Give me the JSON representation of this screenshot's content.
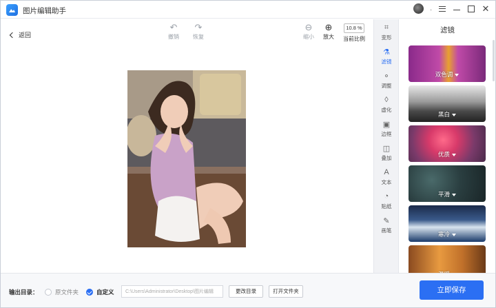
{
  "app": {
    "title": "图片编辑助手",
    "user_dot": "."
  },
  "toolbar": {
    "back": "返回",
    "undo": "撤销",
    "redo": "恢复",
    "zoom_out": "缩小",
    "zoom_in": "放大",
    "zoom_value": "10.8 %",
    "current_ratio": "当前比例"
  },
  "side_tools": [
    {
      "label": "变形",
      "icon": "crop-icon"
    },
    {
      "label": "滤镜",
      "icon": "flask-icon"
    },
    {
      "label": "调整",
      "icon": "adjust-icon"
    },
    {
      "label": "虚化",
      "icon": "drop-icon"
    },
    {
      "label": "边框",
      "icon": "frame-icon"
    },
    {
      "label": "叠加",
      "icon": "layers-icon"
    },
    {
      "label": "文本",
      "icon": "text-icon"
    },
    {
      "label": "贴纸",
      "icon": "sticker-icon"
    },
    {
      "label": "画笔",
      "icon": "brush-icon"
    }
  ],
  "active_tool": "滤镜",
  "filter_panel": {
    "title": "滤镜",
    "filters": [
      {
        "label": "双色调"
      },
      {
        "label": "黑白"
      },
      {
        "label": "优质"
      },
      {
        "label": "平滑"
      },
      {
        "label": "寒冷"
      },
      {
        "label": "温暖"
      }
    ]
  },
  "bottom": {
    "output_label": "输出目录：",
    "option_original": "原文件夹",
    "option_custom": "自定义",
    "path_value": "C:\\Users\\Administrator\\Desktop\\图片编辑",
    "change_dir": "更改目录",
    "open_folder": "打开文件夹",
    "save": "立即保存"
  },
  "colors": {
    "accent": "#2b6ff3"
  }
}
